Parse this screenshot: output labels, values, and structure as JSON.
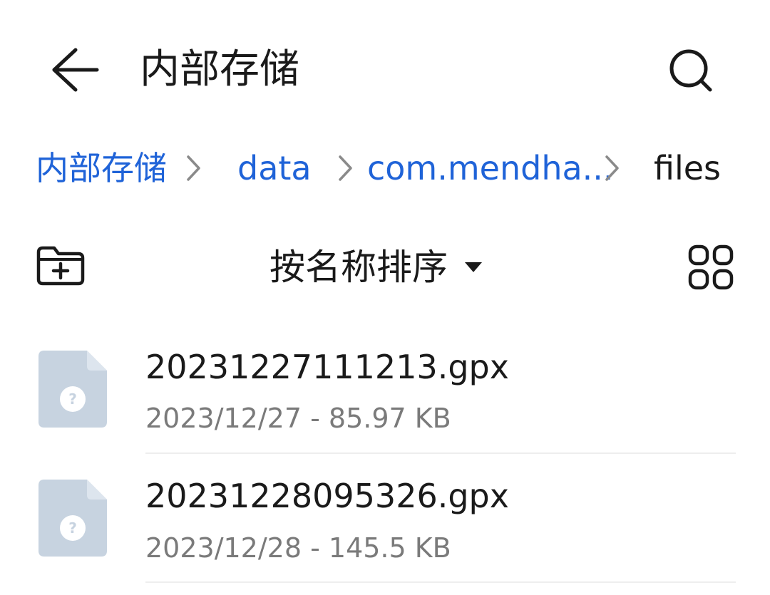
{
  "header": {
    "title": "内部存储"
  },
  "breadcrumb": [
    {
      "label": "内部存储",
      "current": false
    },
    {
      "label": "data",
      "current": false
    },
    {
      "label": "com.mendha...",
      "current": false
    },
    {
      "label": "files",
      "current": true
    }
  ],
  "toolbar": {
    "sort_label": "按名称排序"
  },
  "files": [
    {
      "name": "20231227111213.gpx",
      "meta": "2023/12/27 - 85.97 KB"
    },
    {
      "name": "20231228095326.gpx",
      "meta": "2023/12/28 - 145.5 KB"
    }
  ],
  "colors": {
    "link": "#1f63d8",
    "icon_file": "#c7d3e0",
    "icon_fold": "#dde5ee",
    "text_secondary": "#7a7a7a"
  }
}
